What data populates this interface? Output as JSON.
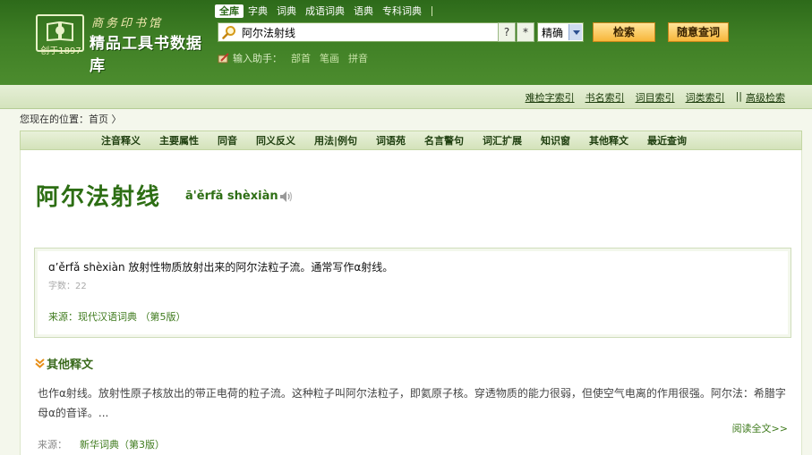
{
  "logo": {
    "publisher": "商务印书馆",
    "title": "精品工具书数据库",
    "founded": "创于1897"
  },
  "scope_tabs": [
    "全库",
    "字典",
    "词典",
    "成语词典",
    "语典",
    "专科词典"
  ],
  "search": {
    "query": "阿尔法射线",
    "btn_question": "?",
    "btn_star": "*",
    "mode": "精确",
    "search_button": "检索",
    "random_button": "随意查词"
  },
  "helper": {
    "label": "输入助手：",
    "links": [
      "部首",
      "笔画",
      "拼音"
    ]
  },
  "index_links": [
    "难检字索引",
    "书名索引",
    "词目索引",
    "词类索引"
  ],
  "advanced_search": "高级检索",
  "breadcrumb": {
    "prefix": "您现在的位置：",
    "home": "首页",
    "arrow": "〉"
  },
  "categories": [
    "注音释义",
    "主要属性",
    "同音",
    "同义反义",
    "用法|例句",
    "词语苑",
    "名言警句",
    "词汇扩展",
    "知识窗",
    "其他释文",
    "最近查询"
  ],
  "entry": {
    "word": "阿尔法射线",
    "pinyin": "ā'ěrfǎ shèxiàn",
    "definition": "ɑ’ěrfǎ shèxiàn 放射性物质放射出来的阿尔法粒子流。通常写作α射线。",
    "char_count": "字数：22",
    "source": "来源：现代汉语词典 （第5版）"
  },
  "other": {
    "title": "其他释文",
    "text": "也作α射线。放射性原子核放出的带正电荷的粒子流。这种粒子叫阿尔法粒子，即氦原子核。穿透物质的能力很弱，但使空气电离的作用很强。阿尔法：希腊字母α的音译。...",
    "read_more": "阅读全文>>",
    "source_label": "来源：",
    "source_book": "新华词典（第3版）"
  },
  "colors": {
    "header_green": "#3f7f25",
    "accent_green": "#2d6e14",
    "button_orange": "#f7b63a"
  }
}
